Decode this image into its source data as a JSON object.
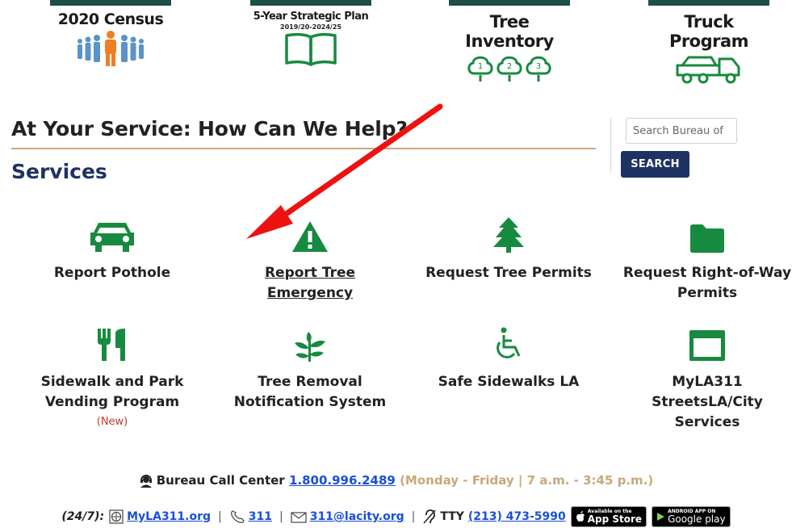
{
  "banners": [
    {
      "title": "2020 Census",
      "subtitle": "",
      "icon": "census-people-icon"
    },
    {
      "title": "5-Year Strategic Plan",
      "subtitle": "2019/20-2024/25",
      "icon": "book-icon"
    },
    {
      "title": "Tree Inventory",
      "subtitle": "",
      "icon": "trees-numbered-icon",
      "numbers": [
        "1",
        "2",
        "3"
      ]
    },
    {
      "title": "Truck Program",
      "subtitle": "",
      "icon": "truck-icon"
    }
  ],
  "help_title": "At Your Service: How Can We Help?",
  "services_title": "Services",
  "search": {
    "placeholder": "Search Bureau of",
    "button_label": "SEARCH"
  },
  "services": [
    {
      "label": "Report Pothole",
      "icon": "car-icon"
    },
    {
      "label": "Report Tree Emergency",
      "icon": "warning-icon",
      "link": true
    },
    {
      "label": "Request Tree Permits",
      "icon": "tree-icon"
    },
    {
      "label": "Request Right-of-Way Permits",
      "icon": "folder-icon"
    },
    {
      "label": "Sidewalk and Park Vending Program",
      "icon": "utensils-icon",
      "note": "(New)"
    },
    {
      "label": "Tree Removal Notification System",
      "icon": "leaf-branch-icon"
    },
    {
      "label": "Safe Sidewalks LA",
      "icon": "wheelchair-icon"
    },
    {
      "label": "MyLA311 StreetsLA/City Services",
      "icon": "window-icon"
    }
  ],
  "call_center": {
    "label": "Bureau Call Center",
    "phone": "1.800.996.2489",
    "hours": "(Monday - Friday | 7 a.m. - 3:45 p.m.)"
  },
  "contact": {
    "availability": "(24/7):",
    "website": "MyLA311.org",
    "phone": "311",
    "email": "311@lacity.org",
    "tty_label": "TTY",
    "tty_phone": "(213) 473-5990",
    "sep": "|",
    "app_store": {
      "small": "Available on the",
      "big": "App Store"
    },
    "google_play": {
      "small": "ANDROID APP ON",
      "big": "Google play"
    }
  },
  "colors": {
    "green": "#188a3f",
    "navy": "#1f3264",
    "tan": "#c8a878",
    "link": "#1a4fd8",
    "arrow": "#ee1111",
    "new": "#c0392b"
  }
}
